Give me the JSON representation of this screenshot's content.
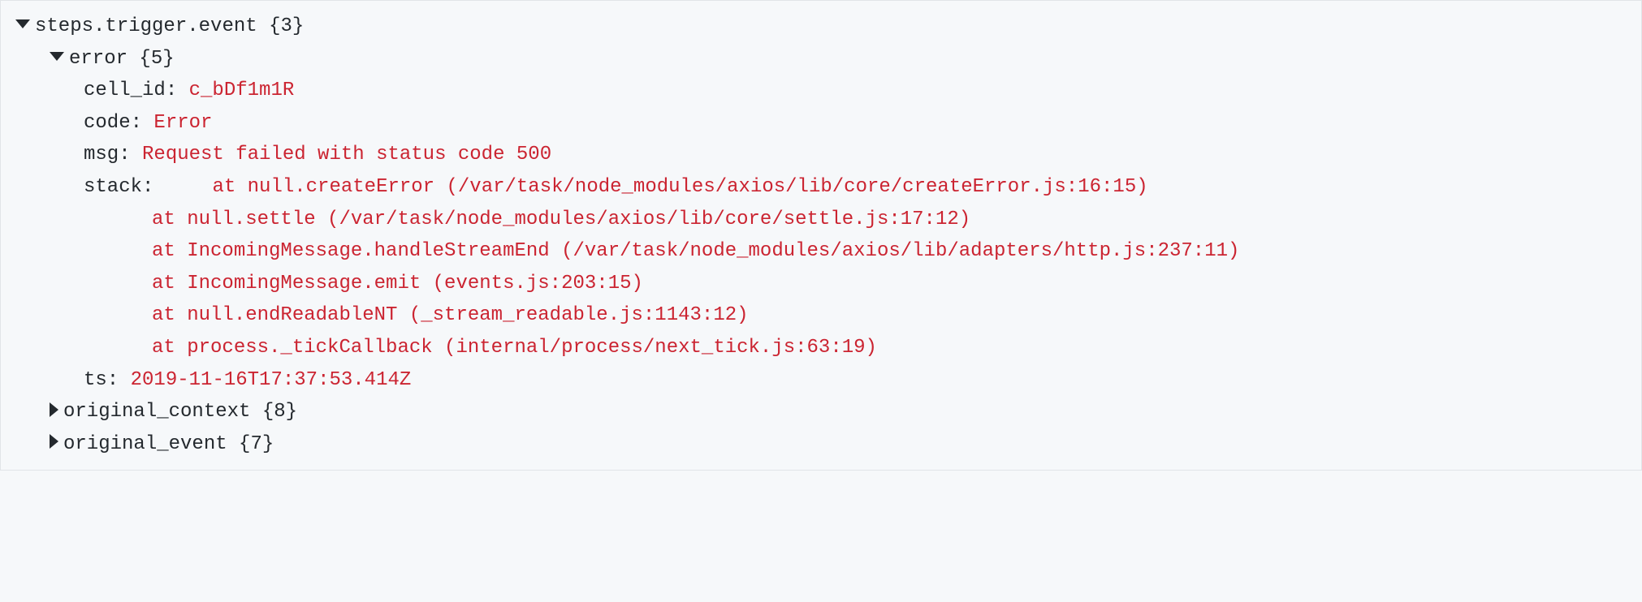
{
  "root": {
    "label": "steps.trigger.event",
    "count": "{3}"
  },
  "error": {
    "label": "error",
    "count": "{5}",
    "cell_id": {
      "key": "cell_id:",
      "value": "c_bDf1m1R"
    },
    "code": {
      "key": "code:",
      "value": "Error"
    },
    "msg": {
      "key": "msg:",
      "value": "Request failed with status code 500"
    },
    "stack": {
      "key": "stack:",
      "lines": [
        "    at null.createError (/var/task/node_modules/axios/lib/core/createError.js:16:15)",
        "at null.settle (/var/task/node_modules/axios/lib/core/settle.js:17:12)",
        "at IncomingMessage.handleStreamEnd (/var/task/node_modules/axios/lib/adapters/http.js:237:11)",
        "at IncomingMessage.emit (events.js:203:15)",
        "at null.endReadableNT (_stream_readable.js:1143:12)",
        "at process._tickCallback (internal/process/next_tick.js:63:19)"
      ]
    },
    "ts": {
      "key": "ts:",
      "value": "2019-11-16T17:37:53.414Z"
    }
  },
  "original_context": {
    "label": "original_context",
    "count": "{8}"
  },
  "original_event": {
    "label": "original_event",
    "count": "{7}"
  }
}
